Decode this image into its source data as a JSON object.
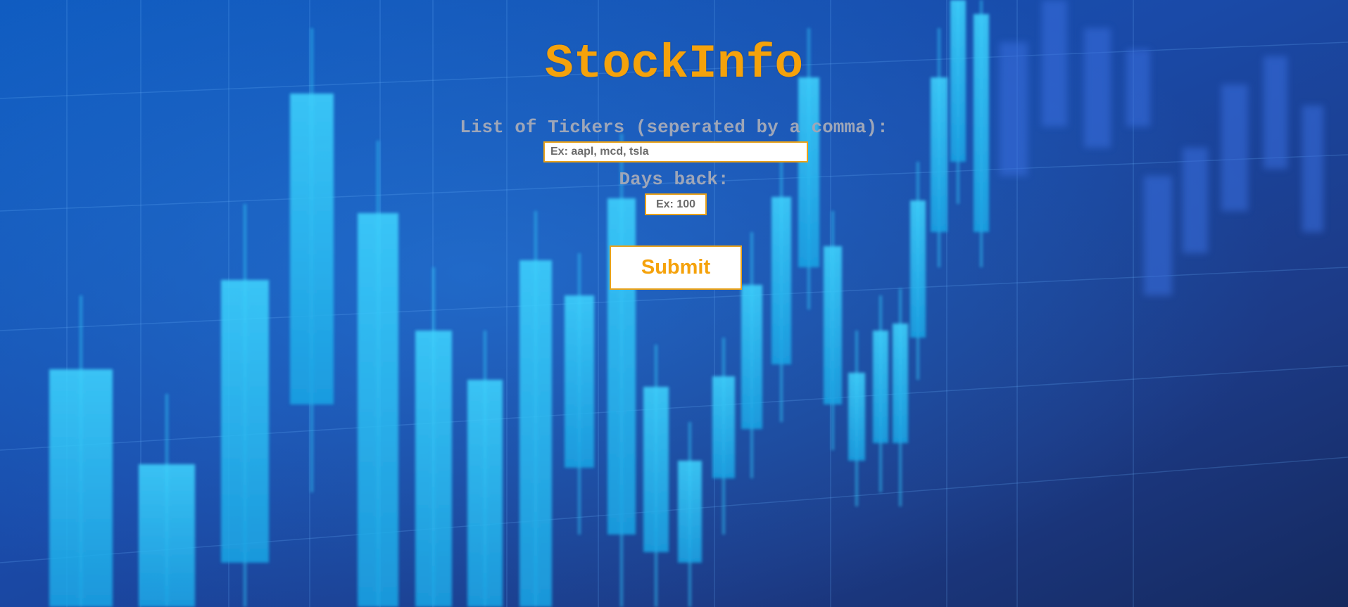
{
  "page": {
    "title": "StockInfo"
  },
  "form": {
    "tickers_label": "List of Tickers (seperated by a comma):",
    "tickers_placeholder": "Ex: aapl, mcd, tsla",
    "days_label": "Days back:",
    "days_placeholder": "Ex: 100",
    "submit_label": "Submit"
  },
  "colors": {
    "accent": "#f5a20b",
    "label_text": "#9ea6b8",
    "input_border": "#e9a21a",
    "background_dark": "#1b3f86",
    "candle": "#27c3f2"
  },
  "background": {
    "description_icon": "stock-candlestick-background"
  }
}
